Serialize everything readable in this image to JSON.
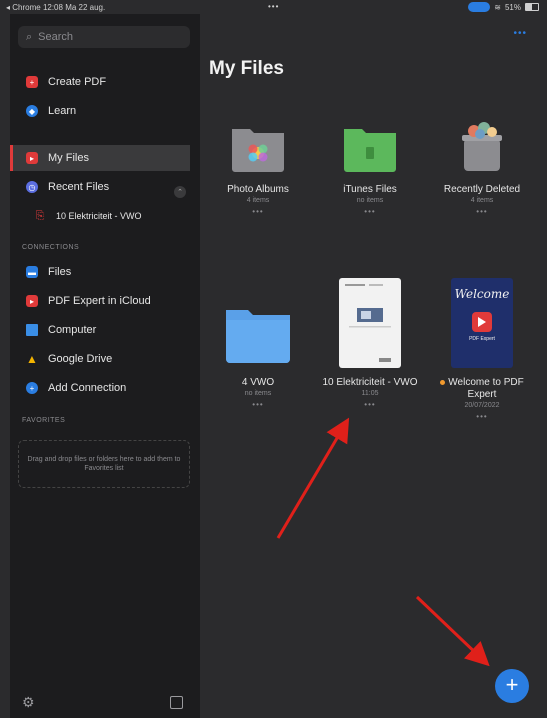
{
  "status_bar": {
    "back_app": "◂ Chrome",
    "time": "12:08",
    "date": "Ma 22 aug.",
    "dots": "•••",
    "battery": "51%"
  },
  "sidebar": {
    "search_placeholder": "Search",
    "items": [
      {
        "label": "Create PDF",
        "icon": "create-pdf-icon",
        "color": "#e03a3a"
      },
      {
        "label": "Learn",
        "icon": "learn-icon",
        "color": "#2a7de1"
      },
      {
        "label": "My Files",
        "icon": "my-files-icon",
        "color": "#e03a3a"
      },
      {
        "label": "Recent Files",
        "icon": "clock-icon",
        "color": "#5b6ee1"
      },
      {
        "label": "10 Elektriciteit - VWO",
        "icon": "pdf-file-icon",
        "color": "#e03a3a"
      }
    ],
    "connections_header": "CONNECTIONS",
    "connections": [
      {
        "label": "Files",
        "icon": "files-icon",
        "color": "#2a7de1"
      },
      {
        "label": "PDF Expert in iCloud",
        "icon": "pdf-expert-icon",
        "color": "#e03a3a"
      },
      {
        "label": "Computer",
        "icon": "computer-icon",
        "color": "#3a8ee6"
      },
      {
        "label": "Google Drive",
        "icon": "google-drive-icon",
        "color": "#f4b400"
      },
      {
        "label": "Add Connection",
        "icon": "plus-icon",
        "color": "#2a7de1"
      }
    ],
    "favorites_header": "FAVORITES",
    "favorites_hint": "Drag and drop files or folders here to add them to Favorites list"
  },
  "main": {
    "title": "My Files",
    "tiles": [
      {
        "label": "Photo Albums",
        "sub": "4 items",
        "dots": "•••",
        "kind": "photos"
      },
      {
        "label": "iTunes Files",
        "sub": "no items",
        "dots": "•••",
        "kind": "itunes"
      },
      {
        "label": "Recently Deleted",
        "sub": "4 items",
        "dots": "•••",
        "kind": "trash"
      },
      {
        "label": "4 VWO",
        "sub": "no items",
        "dots": "•••",
        "kind": "folder"
      },
      {
        "label": "10 Elektriciteit - VWO",
        "sub": "11:05",
        "dots": "•••",
        "kind": "doc"
      },
      {
        "label": "Welcome to PDF Expert",
        "sub": "20/07/2022",
        "dots": "•••",
        "kind": "welcome",
        "unread": true
      }
    ],
    "welcome_cover_text": "Welcome",
    "welcome_cover_sub": "PDF Expert",
    "fab_label": "+"
  },
  "colors": {
    "accent": "#2a7de1",
    "folder": "#5aa0e8",
    "itunes": "#5cb85c",
    "annotation_arrow": "#e0201a"
  }
}
